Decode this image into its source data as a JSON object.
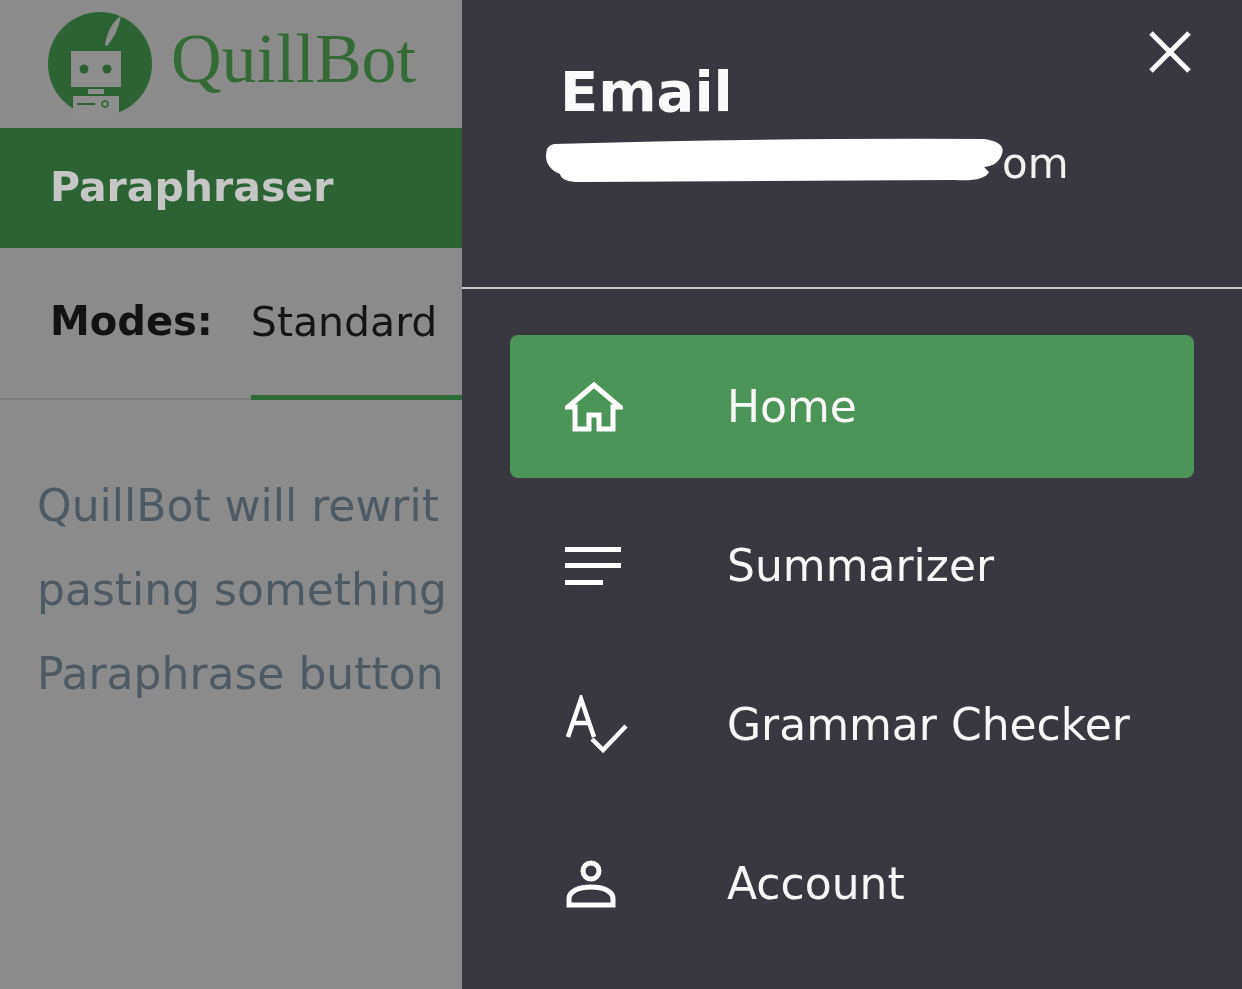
{
  "header": {
    "logo_text": "QuillBot"
  },
  "nav": {
    "title": "Paraphraser"
  },
  "modes": {
    "label": "Modes:",
    "tabs": [
      {
        "label": "Standard",
        "selected": true
      }
    ]
  },
  "intro_lines": [
    "QuillBot will rewrit",
    "pasting something",
    "Paraphrase button"
  ],
  "drawer": {
    "title": "Email",
    "email_redacted": true,
    "email_tail": "om",
    "menu": [
      {
        "label": "Home",
        "selected": true
      },
      {
        "label": "Summarizer",
        "selected": false
      },
      {
        "label": "Grammar Checker",
        "selected": false
      },
      {
        "label": "Account",
        "selected": false
      }
    ]
  }
}
